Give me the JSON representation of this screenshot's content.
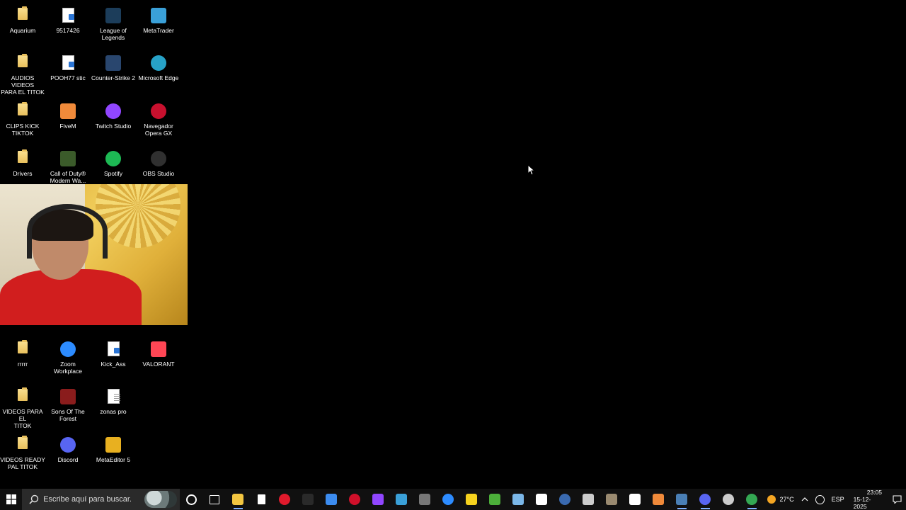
{
  "desktop": {
    "icons": [
      {
        "id": "aquarium",
        "label": "Aquarium",
        "type": "folder"
      },
      {
        "id": "9517426",
        "label": "9517426",
        "type": "doc"
      },
      {
        "id": "lol",
        "label": "League of\nLegends",
        "type": "app",
        "color": "#1c3d5a"
      },
      {
        "id": "metatrader",
        "label": "MetaTrader",
        "type": "app",
        "color": "#3aa0d8"
      },
      {
        "id": "audios",
        "label": "AUDIOS VIDEOS\nPARA EL TITOK",
        "type": "folder"
      },
      {
        "id": "pooh",
        "label": "POOH77 stic",
        "type": "doc"
      },
      {
        "id": "cs2",
        "label": "Counter-Strike 2",
        "type": "app",
        "color": "#29466e"
      },
      {
        "id": "edge",
        "label": "Microsoft Edge",
        "type": "app",
        "color": "#27a2c7"
      },
      {
        "id": "clips",
        "label": "CLIPS KICK\nTIKTOK",
        "type": "folder"
      },
      {
        "id": "fivem",
        "label": "FiveM",
        "type": "app",
        "color": "#f08a3a"
      },
      {
        "id": "twitch",
        "label": "Twitch Studio",
        "type": "app",
        "color": "#9146ff"
      },
      {
        "id": "opera",
        "label": "Navegador\nOpera GX",
        "type": "app",
        "color": "#c8102e"
      },
      {
        "id": "drivers",
        "label": "Drivers",
        "type": "folder"
      },
      {
        "id": "cod",
        "label": "Call of Duty®\nModern Wa...",
        "type": "app",
        "color": "#3b5b2a"
      },
      {
        "id": "spotify",
        "label": "Spotify",
        "type": "app",
        "color": "#1db954"
      },
      {
        "id": "obs",
        "label": "OBS Studio",
        "type": "app",
        "color": "#303030"
      },
      {
        "id": "rrrrr",
        "label": "rrrrr",
        "type": "folder"
      },
      {
        "id": "zoom",
        "label": "Zoom Workplace",
        "type": "app",
        "color": "#2d8cff"
      },
      {
        "id": "kick",
        "label": "Kick_Ass",
        "type": "doc"
      },
      {
        "id": "valorant",
        "label": "VALORANT",
        "type": "app",
        "color": "#ff4655"
      },
      {
        "id": "videos",
        "label": "VIDEOS PARA EL\nTITOK",
        "type": "folder"
      },
      {
        "id": "sotf",
        "label": "Sons Of The\nForest",
        "type": "app",
        "color": "#8a1c1c"
      },
      {
        "id": "zonas",
        "label": "zonas pro",
        "type": "textdoc"
      },
      {
        "id": "ready",
        "label": "VIDEOS READY\nPAL TITOK",
        "type": "folder"
      },
      {
        "id": "discord",
        "label": "Discord",
        "type": "app",
        "color": "#5865f2"
      },
      {
        "id": "metaeditor",
        "label": "MetaEditor 5",
        "type": "app",
        "color": "#e8b020"
      }
    ]
  },
  "taskbar": {
    "search_placeholder": "Escribe aquí para buscar.",
    "pinned": [
      {
        "name": "cortana",
        "color": "#ffffff"
      },
      {
        "name": "task-view",
        "color": "#ffffff"
      },
      {
        "name": "file-explorer",
        "color": "#f3c641"
      },
      {
        "name": "notepad-file",
        "color": "#ffffff"
      },
      {
        "name": "opera",
        "color": "#e01a2c"
      },
      {
        "name": "placeholder",
        "color": "#2a2a2a"
      },
      {
        "name": "copilot",
        "color": "#3c8cf0"
      },
      {
        "name": "red-app",
        "color": "#d0102a"
      },
      {
        "name": "twitch",
        "color": "#9146ff"
      },
      {
        "name": "metatrader",
        "color": "#3aa0d8"
      },
      {
        "name": "calculator",
        "color": "#777777"
      },
      {
        "name": "zoom",
        "color": "#2d8cff"
      },
      {
        "name": "sticky-notes",
        "color": "#f6d21e"
      },
      {
        "name": "minecraft",
        "color": "#4caf3a"
      },
      {
        "name": "notepad",
        "color": "#7bb7e8"
      },
      {
        "name": "capcut",
        "color": "#ffffff"
      },
      {
        "name": "arknights",
        "color": "#3a6ab0"
      },
      {
        "name": "settings",
        "color": "#cccccc"
      },
      {
        "name": "game",
        "color": "#9a8a70"
      },
      {
        "name": "tiktok",
        "color": "#ffffff"
      },
      {
        "name": "fivem",
        "color": "#f08a3a"
      },
      {
        "name": "steam",
        "color": "#4a7fb5"
      },
      {
        "name": "discord",
        "color": "#5865f2"
      },
      {
        "name": "obs",
        "color": "#cccccc"
      },
      {
        "name": "chrome",
        "color": "#34a853"
      }
    ],
    "weather": "27°C",
    "language": "ESP",
    "time": "23:05",
    "date": "15-12-2025"
  }
}
